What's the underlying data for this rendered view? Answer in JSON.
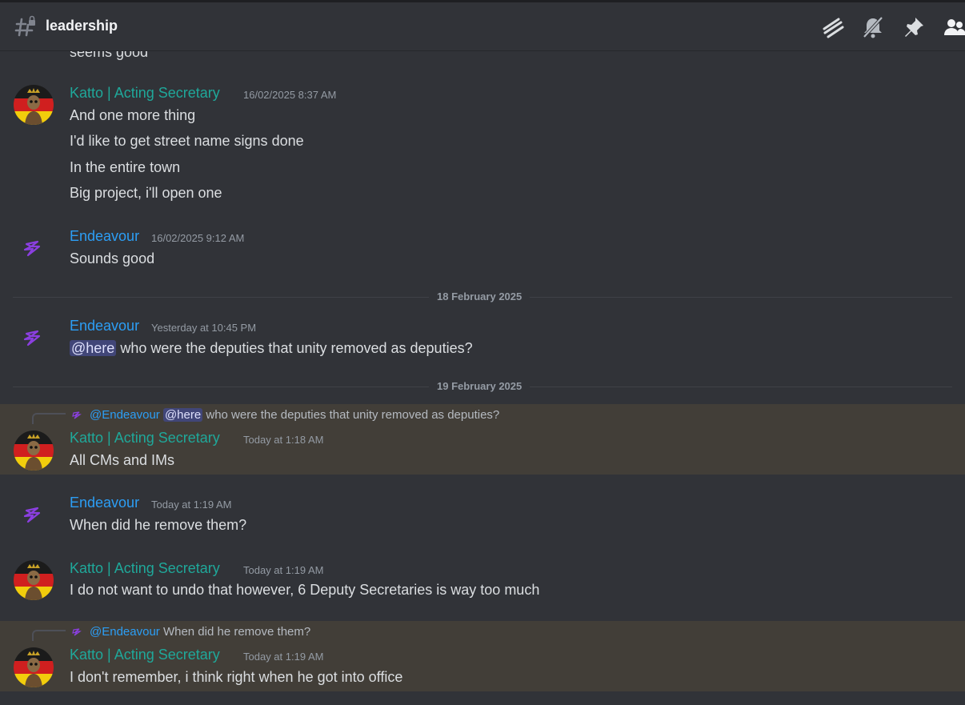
{
  "channel": {
    "name": "leadership"
  },
  "toolbar": {
    "icons": [
      "threads-icon",
      "mute-bell-icon",
      "pin-icon",
      "members-icon"
    ]
  },
  "colors": {
    "teal": "#1fa89a",
    "blue": "#2c9ef5",
    "highlight": "#423e38",
    "mention_bg": "#414678"
  },
  "messages": {
    "m0": {
      "text": "seems good"
    },
    "m1": {
      "author": "Katto | Acting Secretary",
      "time": "16/02/2025 8:37 AM",
      "lines": [
        "And one more thing",
        "I'd like to get street name signs done",
        "In the entire town",
        "Big project, i'll open one"
      ]
    },
    "m2": {
      "author": "Endeavour",
      "time": "16/02/2025 9:12 AM",
      "text": "Sounds good"
    },
    "div1": "18 February 2025",
    "m3": {
      "author": "Endeavour",
      "time": "Yesterday at 10:45 PM",
      "mention": "@here",
      "text": " who were the deputies that unity removed as deputies?"
    },
    "div2": "19 February 2025",
    "m4": {
      "reply_who": "@Endeavour",
      "reply_mention": "@here",
      "reply_text": " who were the deputies that unity removed as deputies?",
      "author": "Katto | Acting Secretary",
      "time": "Today at 1:18 AM",
      "text": "All CMs and IMs"
    },
    "m5": {
      "author": "Endeavour",
      "time": "Today at 1:19 AM",
      "text": "When did he remove them?"
    },
    "m6": {
      "author": "Katto | Acting Secretary",
      "time": "Today at 1:19 AM",
      "text": "I do not want to undo that however, 6 Deputy Secretaries is way too much"
    },
    "m7": {
      "reply_who": "@Endeavour",
      "reply_text": " When did he remove them?",
      "author": "Katto | Acting Secretary",
      "time": "Today at 1:19 AM",
      "text": "I don't remember, i think right when he got into office"
    }
  }
}
